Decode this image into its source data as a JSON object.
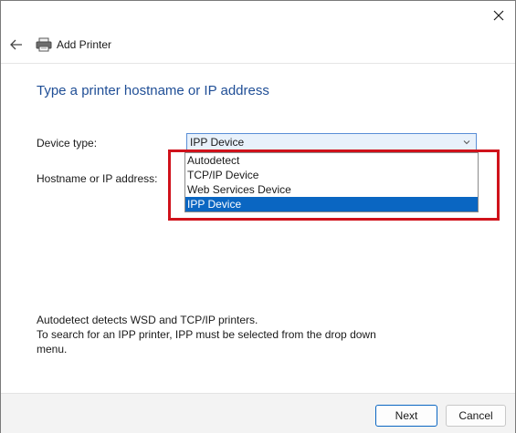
{
  "window": {
    "title": "Add Printer"
  },
  "page": {
    "heading": "Type a printer hostname or IP address"
  },
  "form": {
    "device_type_label": "Device type:",
    "device_type_value": "IPP Device",
    "hostname_label": "Hostname or IP address:"
  },
  "dropdown": {
    "options": [
      "Autodetect",
      "TCP/IP Device",
      "Web Services Device",
      "IPP Device"
    ],
    "selected": "IPP Device"
  },
  "help": {
    "line1": "Autodetect detects WSD and TCP/IP printers.",
    "line2": "To search for an IPP printer, IPP must be selected from the drop down",
    "line3": "menu."
  },
  "buttons": {
    "next": "Next",
    "cancel": "Cancel"
  },
  "colors": {
    "heading": "#1f4e96",
    "selection": "#0a66c2",
    "highlight_box": "#d0121b"
  },
  "icons": {
    "close": "close-icon",
    "back": "back-arrow-icon",
    "printer": "printer-icon",
    "chevron": "chevron-down-icon"
  }
}
